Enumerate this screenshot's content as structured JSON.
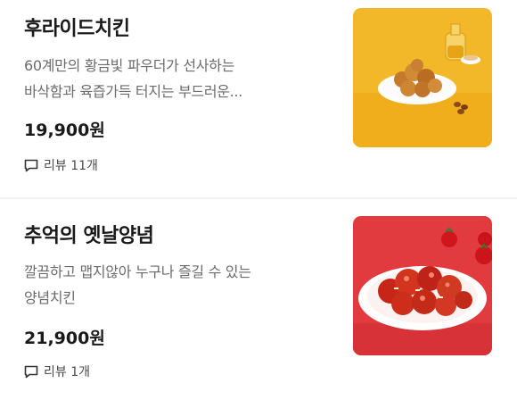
{
  "menu_items": [
    {
      "name": "후라이드치킨",
      "description_lines": [
        "60계만의 황금빛 파우더가 선사하는",
        "바삭함과 육즙가득 터지는 부드러운..."
      ],
      "price": "19,900원",
      "review": "리뷰 11개",
      "image": "fried-chicken-photo",
      "colors": {
        "bg": "#f3b82a"
      }
    },
    {
      "name": "추억의 옛날양념",
      "description_lines": [
        "깔끔하고 맵지않아 누구나 즐길 수 있는",
        "양념치킨"
      ],
      "price": "21,900원",
      "review": "리뷰 1개",
      "image": "seasoned-chicken-photo",
      "colors": {
        "bg": "#e23b3f"
      }
    }
  ]
}
